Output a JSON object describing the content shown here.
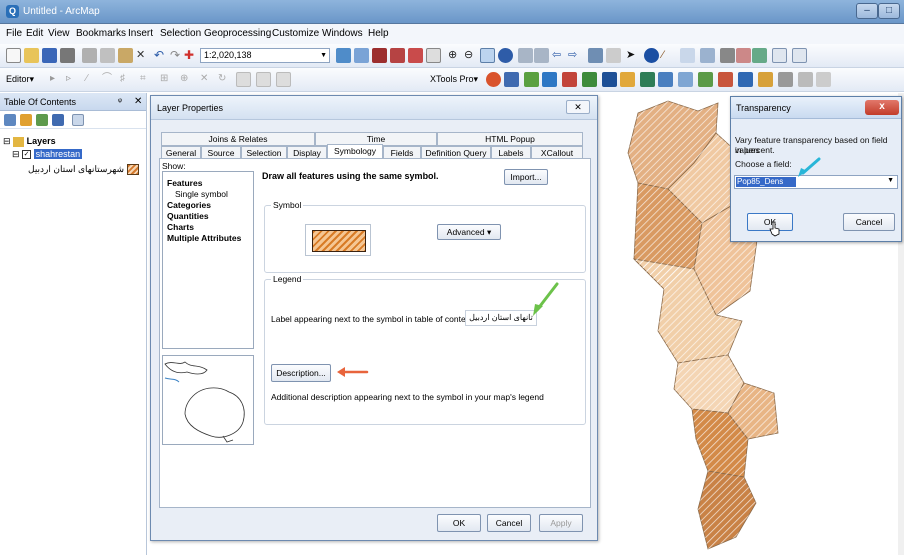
{
  "window": {
    "title": "Untitled - ArcMap",
    "min_glyph": "–",
    "max_glyph": "□"
  },
  "menu": [
    "File",
    "Edit",
    "View",
    "Bookmarks",
    "Insert",
    "Selection",
    "Geoprocessing",
    "Customize",
    "Windows",
    "Help"
  ],
  "toolbar": {
    "scale": "1:2,020,138",
    "editor_label": "Editor▾",
    "xtools_label": "XTools Pro▾"
  },
  "toc": {
    "title": "Table Of Contents",
    "pin": "ᵠ",
    "close": "✕",
    "layers_label": "Layers",
    "layer_name": "shahrestan",
    "legend_label": "شهرستانهای استان اردبیل"
  },
  "layer_properties": {
    "title": "Layer Properties",
    "close": "✕",
    "tabs_row1": [
      "Joins & Relates",
      "Time",
      "HTML Popup"
    ],
    "tabs_row2": [
      "General",
      "Source",
      "Selection",
      "Display",
      "Symbology",
      "Fields",
      "Definition Query",
      "Labels",
      "XCallout"
    ],
    "active_tab": "Symbology",
    "show_label": "Show:",
    "show_items": [
      "Features",
      "Single symbol",
      "Categories",
      "Quantities",
      "Charts",
      "Multiple Attributes"
    ],
    "heading": "Draw all features using the same symbol.",
    "import_button": "Import...",
    "symbol_group": "Symbol",
    "advanced_button": "Advanced ▾",
    "legend_group": "Legend",
    "label_prompt": "Label appearing next to the symbol in table of contents:",
    "label_value": "تانهای استان اردبیل",
    "description_button": "Description...",
    "description_hint": "Additional description appearing next to the symbol in your map's legend",
    "ok": "OK",
    "cancel": "Cancel",
    "apply": "Apply"
  },
  "transparency": {
    "title": "Transparency",
    "close": "x",
    "text1": "Vary feature transparency based on field values",
    "text2": "in percent.",
    "choose": "Choose a field:",
    "field": "Pop85_Dens",
    "ok": "OK",
    "cancel": "Cancel"
  },
  "colors": {
    "accent": "#2f6fc0",
    "symbol_fill": "#d87b26",
    "arrow_green": "#6cc24a",
    "arrow_orange": "#e8643c"
  }
}
